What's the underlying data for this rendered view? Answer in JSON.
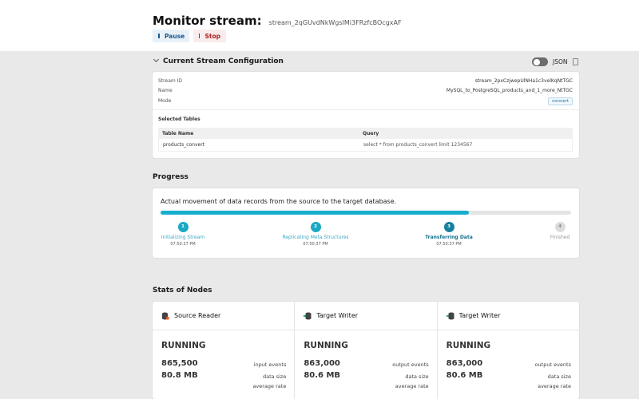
{
  "header": {
    "title": "Monitor stream:",
    "stream_id": "stream_2qGUvdNkWgsIMi3FRzfcBOcgxAF",
    "pause_label": "Pause",
    "stop_label": "Stop"
  },
  "config": {
    "section_title": "Current Stream Configuration",
    "json_label": "JSON",
    "fields": [
      {
        "label": "Stream ID",
        "value": "stream_2pxCzjwepUlNHa1c3velKqNtTGC"
      },
      {
        "label": "Name",
        "value": "MySQL_to_PostgreSQL_products_and_1_more_NtTGC"
      },
      {
        "label": "Mode",
        "value": "convert"
      }
    ],
    "selected_tables_label": "Selected Tables",
    "table": {
      "headers": [
        "Table Name",
        "Query"
      ],
      "rows": [
        [
          "products_convert",
          "select * from products_convert limit 1234567"
        ]
      ]
    }
  },
  "progress": {
    "section_title": "Progress",
    "description": "Actual movement of data records from the source to the target database.",
    "percent": 75,
    "steps": [
      {
        "num": "1",
        "label": "Initializing Stream",
        "time": "07:50:37 PM",
        "state": "done"
      },
      {
        "num": "2",
        "label": "Replicating Meta Structures",
        "time": "07:50:37 PM",
        "state": "done"
      },
      {
        "num": "3",
        "label": "Transferring Data",
        "time": "07:50:37 PM",
        "state": "current"
      },
      {
        "num": "4",
        "label": "Finished",
        "time": "",
        "state": "pending"
      }
    ]
  },
  "stats": {
    "section_title": "Stats of Nodes",
    "nodes": [
      {
        "name": "Source Reader",
        "status": "RUNNING",
        "events": "865,500",
        "events_label": "input events",
        "size": "80.8 MB",
        "size_label": "data size",
        "rate_label": "average rate",
        "icon": "source-db-icon"
      },
      {
        "name": "Target Writer",
        "status": "RUNNING",
        "events": "863,000",
        "events_label": "output events",
        "size": "80.6 MB",
        "size_label": "data size",
        "rate_label": "average rate",
        "icon": "target-db-icon"
      },
      {
        "name": "Target Writer",
        "status": "RUNNING",
        "events": "863,000",
        "events_label": "output events",
        "size": "80.6 MB",
        "size_label": "data size",
        "rate_label": "average rate",
        "icon": "target-db-icon"
      }
    ]
  },
  "colors": {
    "accent": "#17aecd",
    "stop": "#d01919",
    "pause": "#1e5a92"
  }
}
